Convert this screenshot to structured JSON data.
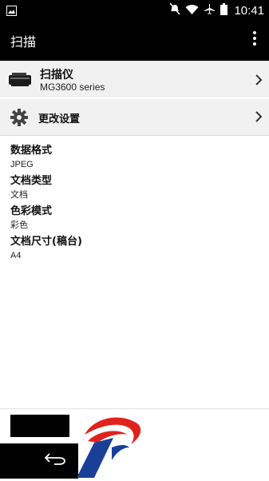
{
  "status_bar": {
    "time": "10:41",
    "icons": [
      "image-icon",
      "mute-icon",
      "wifi-icon",
      "airplane-icon",
      "battery-icon"
    ]
  },
  "app_bar": {
    "title": "扫描",
    "menu_icon": "overflow-menu-icon"
  },
  "scanner": {
    "title": "扫描仪",
    "model": "MG3600 series",
    "icon": "printer-icon"
  },
  "settings": {
    "label": "更改设置",
    "icon": "gear-icon"
  },
  "info": [
    {
      "label": "数据格式",
      "value": "JPEG"
    },
    {
      "label": "文档类型",
      "value": "文档"
    },
    {
      "label": "色彩模式",
      "value": "彩色"
    },
    {
      "label": "文档尺寸(稿台)",
      "value": "A4"
    }
  ],
  "nav": {
    "back_icon": "back-icon"
  },
  "colors": {
    "bar": "#000000",
    "row_bg": "#f1f1f1",
    "logo_red": "#e0211d",
    "logo_blue": "#1a3f99"
  }
}
